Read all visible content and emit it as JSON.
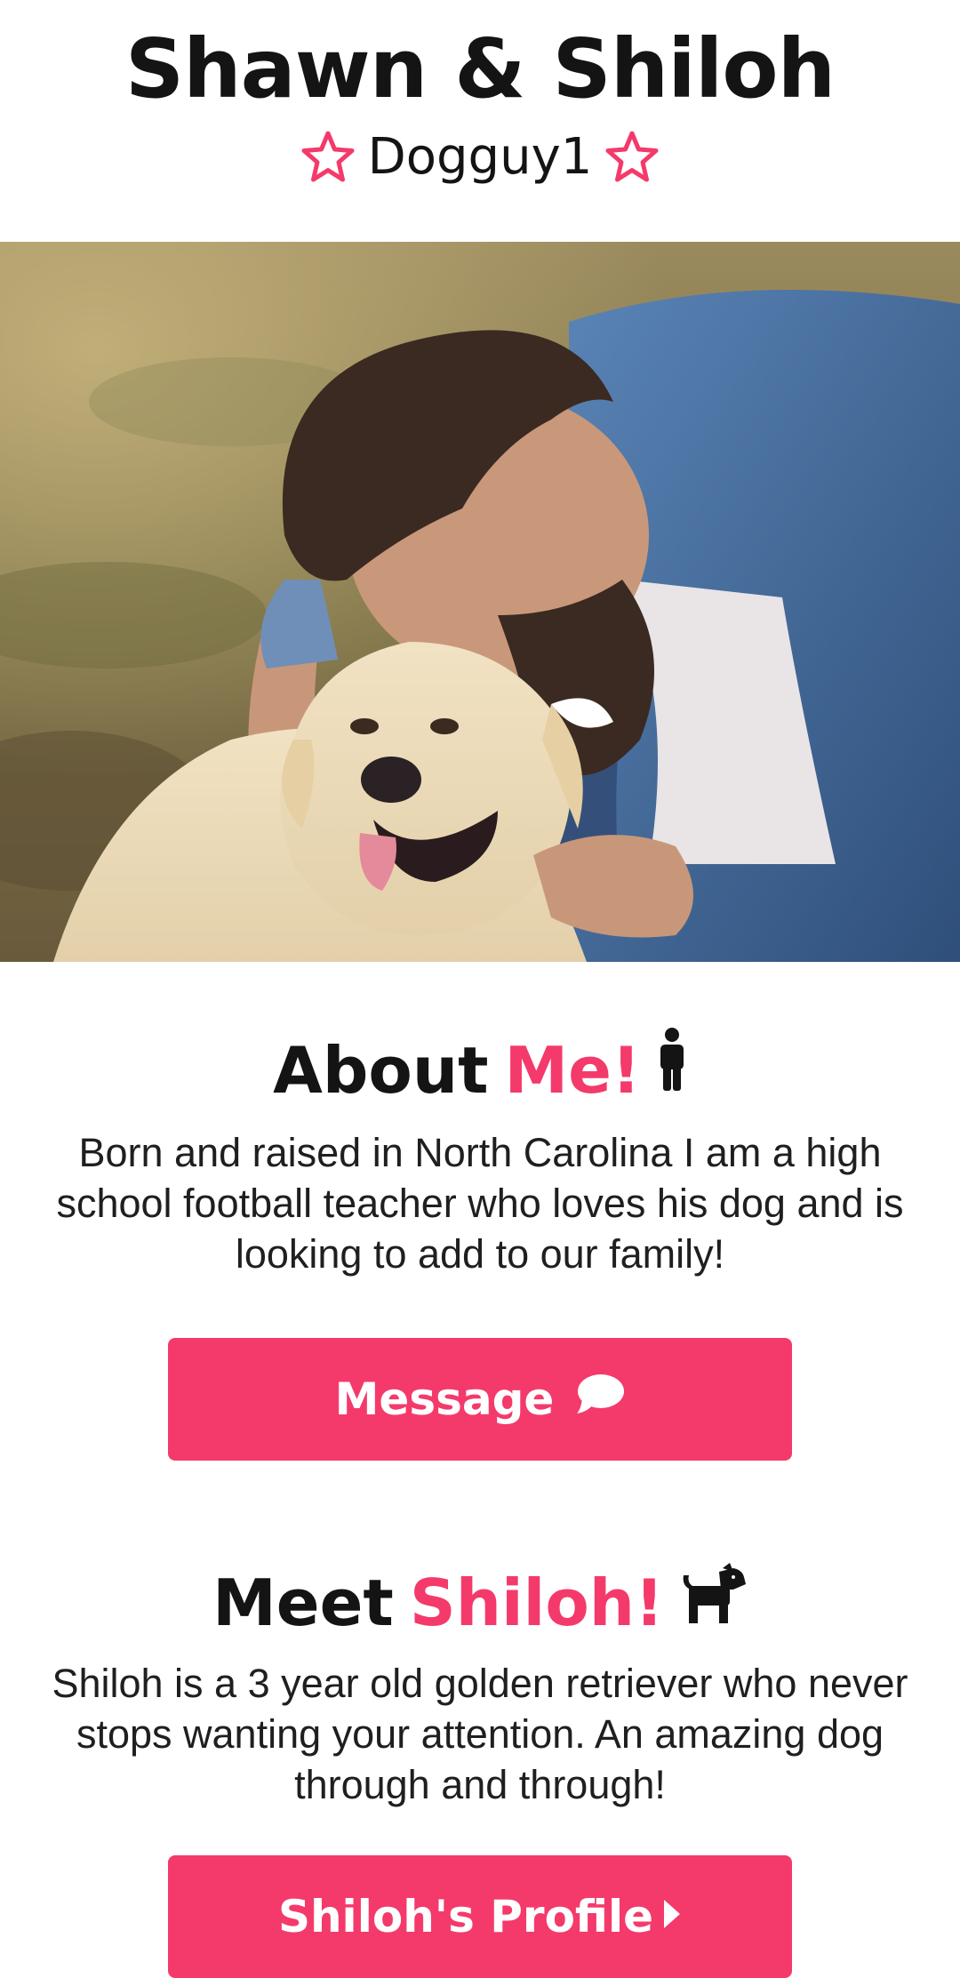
{
  "header": {
    "title": "Shawn & Shiloh",
    "username": "Dogguy1",
    "star_icon": "star-outline-icon"
  },
  "hero": {
    "description": "photo"
  },
  "about": {
    "heading_plain": "About",
    "heading_accent": "Me!",
    "icon": "person-icon",
    "text": "Born and raised in North Carolina I am a high school football teacher who loves his dog and is looking to add to our family!"
  },
  "message_button": {
    "label": "Message",
    "icon": "chat-bubble-icon"
  },
  "pet": {
    "heading_plain": "Meet",
    "heading_accent": "Shiloh!",
    "icon": "dog-icon",
    "text": "Shiloh is a 3 year old golden retriever who never stops wanting your attention. An amazing dog through and through!"
  },
  "profile_button": {
    "label": "Shiloh's Profile",
    "icon": "caret-right-icon"
  },
  "colors": {
    "accent": "#f43a6b",
    "text": "#141414",
    "background": "#ffffff"
  }
}
